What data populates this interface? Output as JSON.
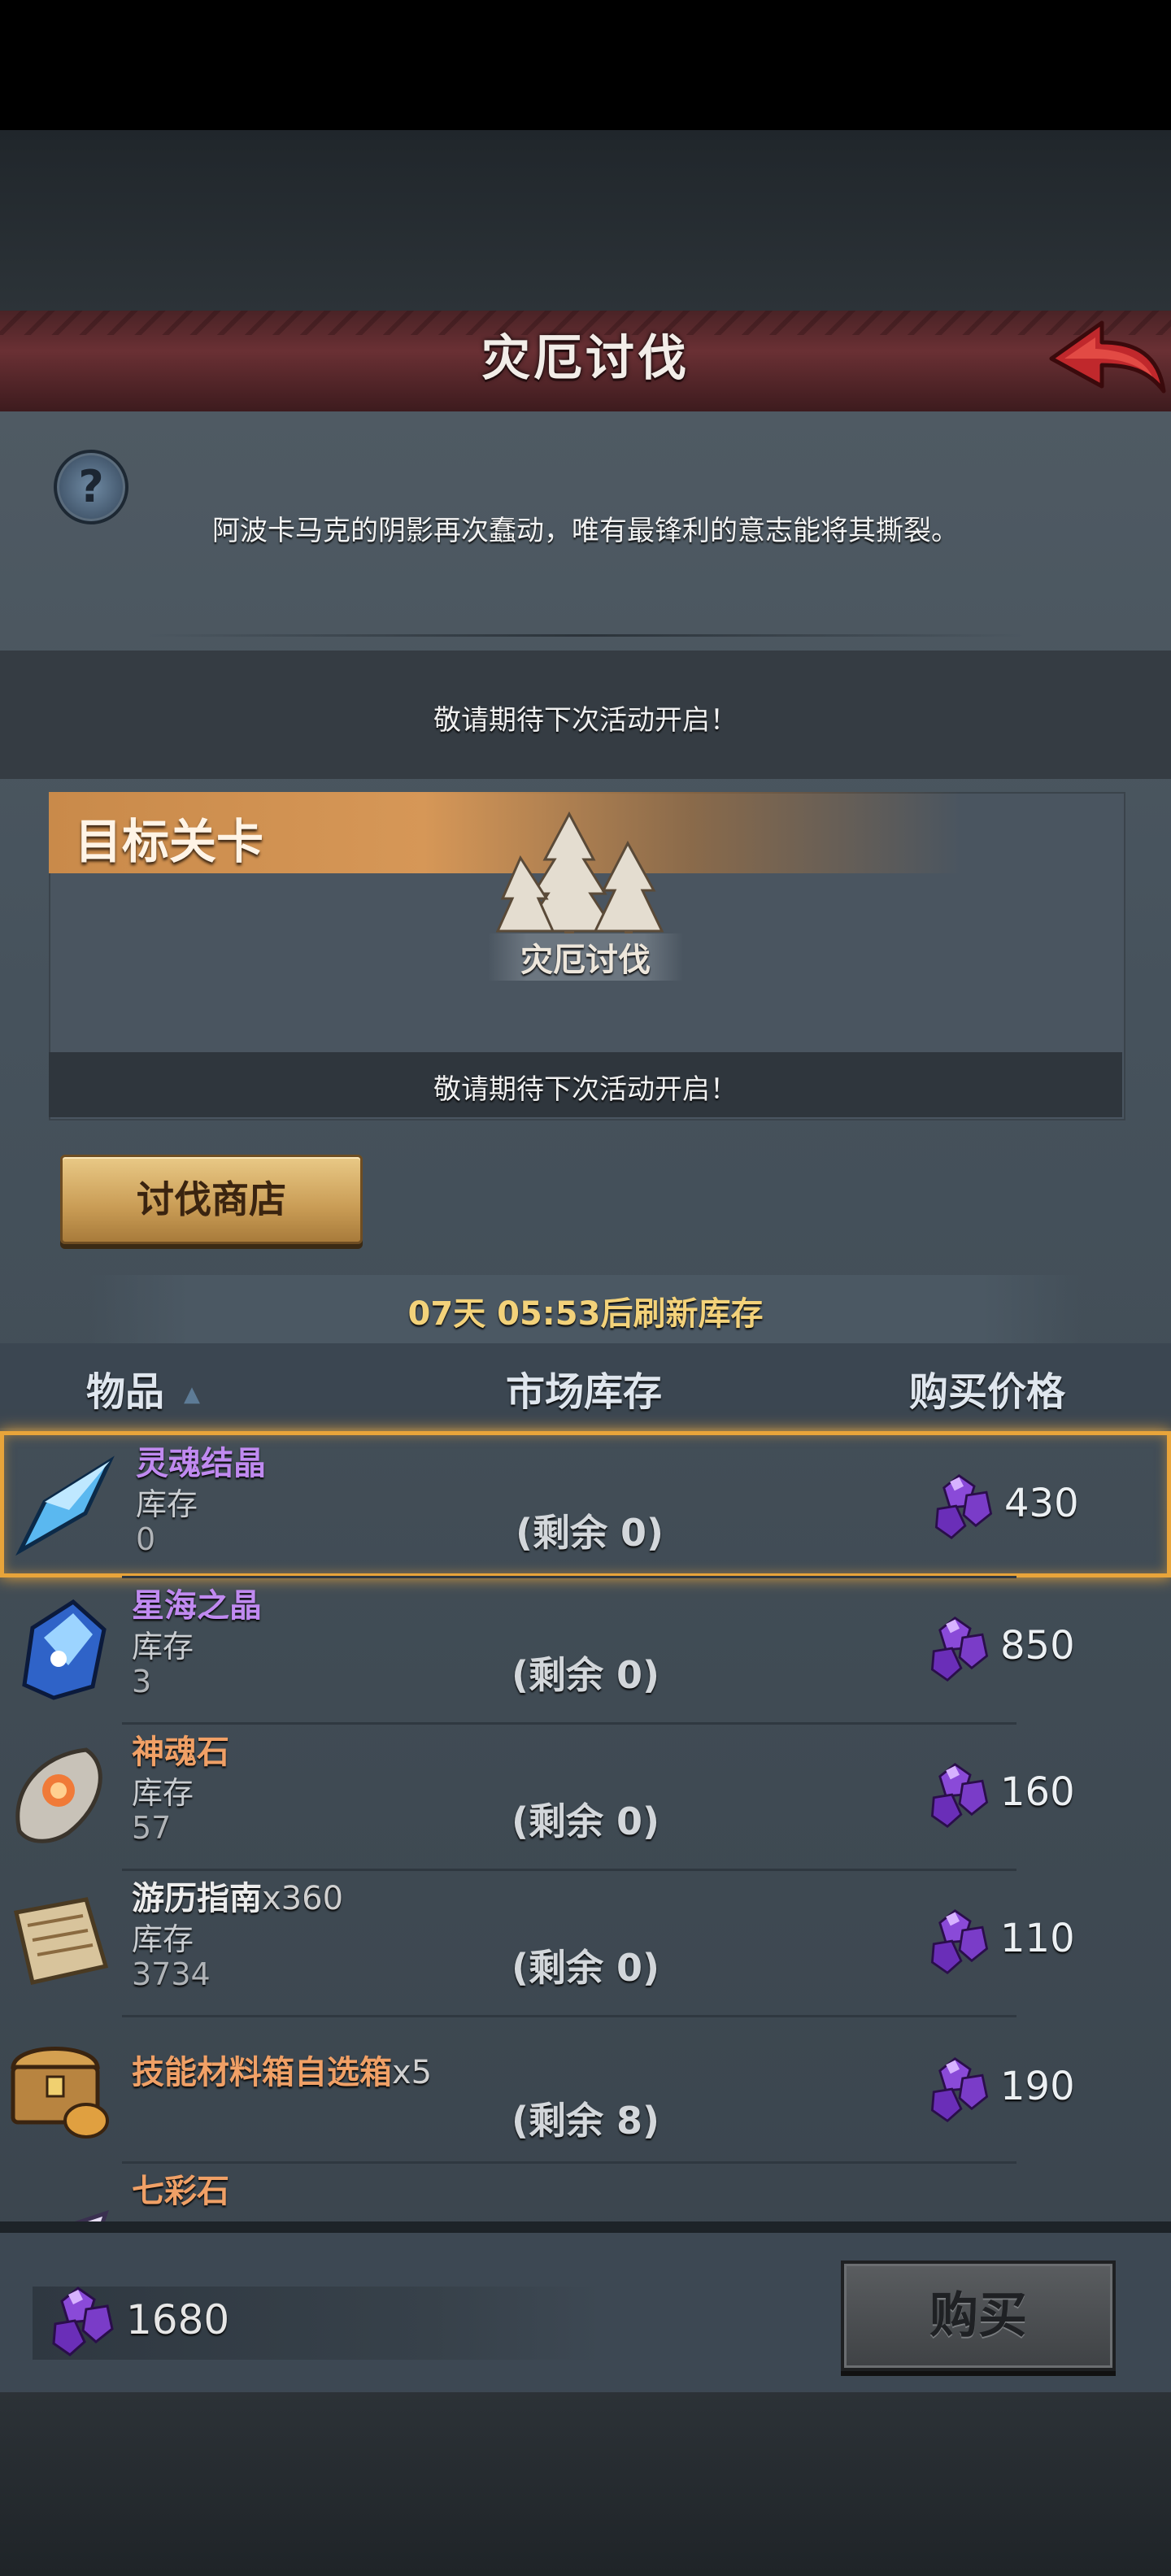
{
  "header": {
    "title": "灾厄讨伐"
  },
  "intro": {
    "description": "阿波卡马克的阴影再次蠢动，唯有最锋利的意志能将其撕裂。",
    "notice": "敬请期待下次活动开启！"
  },
  "target": {
    "section_title": "目标关卡",
    "stage_name": "灾厄讨伐",
    "notice": "敬请期待下次活动开启！"
  },
  "shop": {
    "button_label": "讨伐商店",
    "refresh_text": "07天 05:53后刷新库存",
    "columns": {
      "item": "物品",
      "market_stock": "市场库存",
      "price": "购买价格"
    },
    "items": [
      {
        "name": "灵魂结晶",
        "qty": "",
        "stock_label": "库存",
        "stock": "0",
        "remain": "(剩余 0)",
        "price": "430",
        "color": "#c08af0",
        "icon": "crystal-shard-icon"
      },
      {
        "name": "星海之晶",
        "qty": "",
        "stock_label": "库存",
        "stock": "3",
        "remain": "(剩余 0)",
        "price": "850",
        "color": "#c08af0",
        "icon": "star-sea-crystal-icon"
      },
      {
        "name": "神魂石",
        "qty": "",
        "stock_label": "库存",
        "stock": "57",
        "remain": "(剩余 0)",
        "price": "160",
        "color": "#f0a066",
        "icon": "soul-stone-icon"
      },
      {
        "name": "游历指南",
        "qty": "x360",
        "stock_label": "库存",
        "stock": "3734",
        "remain": "(剩余 0)",
        "price": "110",
        "color": "#ececec",
        "icon": "scroll-icon"
      },
      {
        "name": "技能材料箱自选箱",
        "qty": "x5",
        "stock_label": "",
        "stock": "",
        "remain": "(剩余 8)",
        "price": "190",
        "color": "#f0a066",
        "icon": "treasure-chest-icon"
      },
      {
        "name": "七彩石",
        "qty": "",
        "stock_label": "",
        "stock": "",
        "remain": "",
        "price": "",
        "color": "#f0a066",
        "icon": "rainbow-stone-icon"
      }
    ]
  },
  "footer": {
    "balance": "1680",
    "buy_label": "购买"
  },
  "colors": {
    "selected_border": "#e8a43a",
    "currency_gem": "#7a3cc8",
    "title_bar": "#6a3034"
  }
}
